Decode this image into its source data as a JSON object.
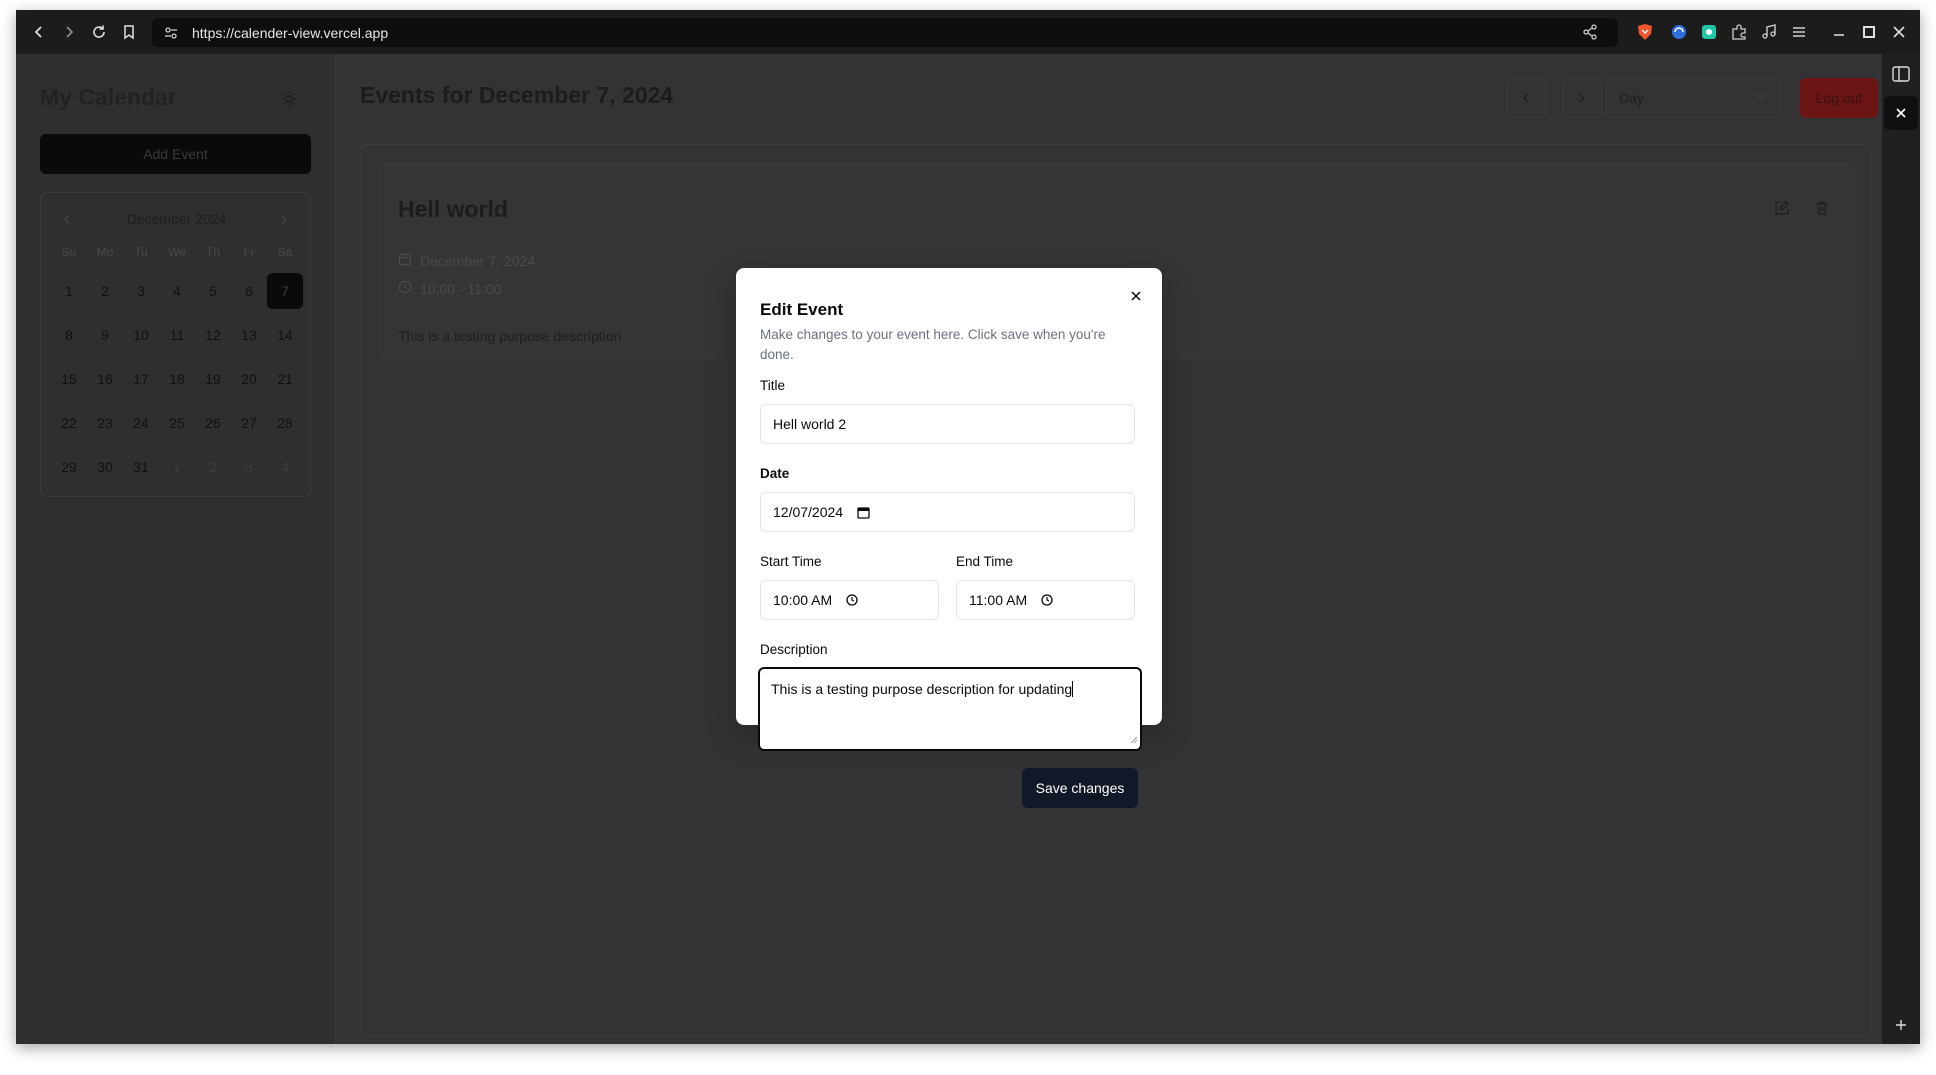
{
  "browser": {
    "url": "https://calender-view.vercel.app",
    "icons": [
      "back-icon",
      "forward-icon",
      "reload-icon",
      "bookmark-icon",
      "site-settings-icon",
      "share-icon",
      "brave-shield-icon",
      "extension-icon",
      "puzzle-icon",
      "music-icon",
      "menu-icon",
      "minimize-icon",
      "maximize-icon",
      "close-icon"
    ]
  },
  "sidebar": {
    "title": "My Calendar",
    "add_event_label": "Add Event",
    "calendar": {
      "month_label": "December 2024",
      "weekdays": [
        "Su",
        "Mo",
        "Tu",
        "We",
        "Th",
        "Fr",
        "Sa"
      ],
      "weeks": [
        [
          "1",
          "2",
          "3",
          "4",
          "5",
          "6",
          "7"
        ],
        [
          "8",
          "9",
          "10",
          "11",
          "12",
          "13",
          "14"
        ],
        [
          "15",
          "16",
          "17",
          "18",
          "19",
          "20",
          "21"
        ],
        [
          "22",
          "23",
          "24",
          "25",
          "26",
          "27",
          "28"
        ],
        [
          "29",
          "30",
          "31",
          "1",
          "2",
          "3",
          "4"
        ]
      ],
      "selected_day": "7"
    }
  },
  "main": {
    "title": "Events for December 7, 2024",
    "view_select": "Day",
    "logout_label": "Log out",
    "event": {
      "title": "Hell world",
      "date": "December 7, 2024",
      "time": "10:00 - 11:00",
      "description": "This is a testing purpose description"
    }
  },
  "modal": {
    "title": "Edit Event",
    "description": "Make changes to your event here. Click save when you're done.",
    "title_label": "Title",
    "title_value": "Hell world 2",
    "date_label": "Date",
    "date_value": "12/07/2024",
    "start_label": "Start Time",
    "start_value": "10:00 AM",
    "end_label": "End Time",
    "end_value": "11:00 AM",
    "description_label": "Description",
    "description_value": "This is a testing purpose description for updating",
    "save_label": "Save changes"
  },
  "colors": {
    "overlay_bg": "#333336",
    "accent_dark": "#111827",
    "logout_red": "#6b1515"
  }
}
